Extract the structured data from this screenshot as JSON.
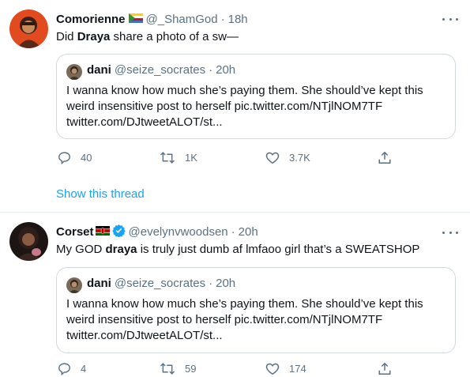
{
  "tweets": [
    {
      "name": "Comorienne",
      "handle": "@_ShamGod",
      "time": "18h",
      "text_before": "Did ",
      "text_bold": "Draya",
      "text_after": " share a photo of a sw—",
      "quote": {
        "name": "dani",
        "handle": "@seize_socrates",
        "time": "20h",
        "line1": "I wanna know how much she’s paying them. She should’ve kept this",
        "line2": "weird insensitive post to herself pic.twitter.com/NTjlNOM7TF",
        "line3": "twitter.com/DJtweetALOT/st..."
      },
      "replies": "40",
      "retweets": "1K",
      "likes": "3.7K",
      "show_thread": "Show this thread"
    },
    {
      "name": "Corset",
      "handle": "@evelynvwoodsen",
      "time": "20h",
      "text_before": "My GOD ",
      "text_bold": "draya",
      "text_after": " is truly just dumb af lmfaoo girl that’s a SWEATSHOP",
      "quote": {
        "name": "dani",
        "handle": "@seize_socrates",
        "time": "20h",
        "line1": "I wanna know how much she’s paying them. She should’ve kept this",
        "line2": "weird insensitive post to herself pic.twitter.com/NTjlNOM7TF",
        "line3": "twitter.com/DJtweetALOT/st..."
      },
      "replies": "4",
      "retweets": "59",
      "likes": "174"
    }
  ],
  "separator": "·",
  "icons": {
    "reply": "reply-icon",
    "retweet": "retweet-icon",
    "like": "heart-icon",
    "share": "share-icon",
    "more": "more-icon",
    "verified": "verified-badge-icon",
    "flag_comoros": "comoros-flag-icon",
    "flag_kenya": "kenya-flag-icon"
  },
  "colors": {
    "link": "#1da1f2",
    "secondary_text": "#5b7083",
    "border": "#cfd9de",
    "divider": "#e6ecf0"
  }
}
